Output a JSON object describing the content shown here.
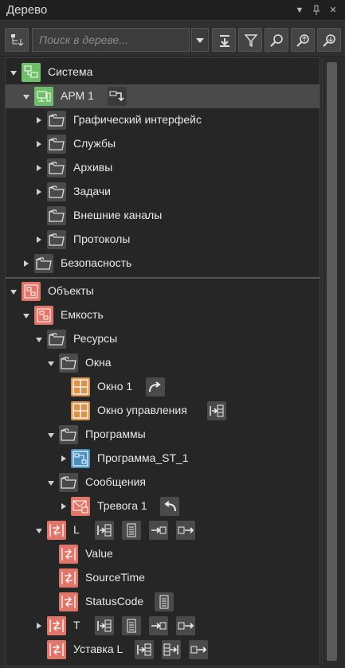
{
  "window": {
    "title": "Дерево"
  },
  "toolbar": {
    "search_placeholder": "Поиск в дереве..."
  },
  "tree": {
    "system": "Система",
    "arm": "АРМ 1",
    "gui": "Графический интерфейс",
    "services": "Службы",
    "archives": "Архивы",
    "tasks": "Задачи",
    "ext_channels": "Внешние каналы",
    "protocols": "Протоколы",
    "security": "Безопасность",
    "objects": "Объекты",
    "capacity": "Емкость",
    "resources": "Ресурсы",
    "windows": "Окна",
    "window1": "Окно 1",
    "control_window": "Окно управления",
    "programs": "Программы",
    "program_st1": "Программа_ST_1",
    "messages": "Сообщения",
    "alarm1": "Тревога 1",
    "l": "L",
    "value": "Value",
    "source_time": "SourceTime",
    "status_code": "StatusCode",
    "t": "T",
    "setpoint_l": "Уставка L"
  }
}
